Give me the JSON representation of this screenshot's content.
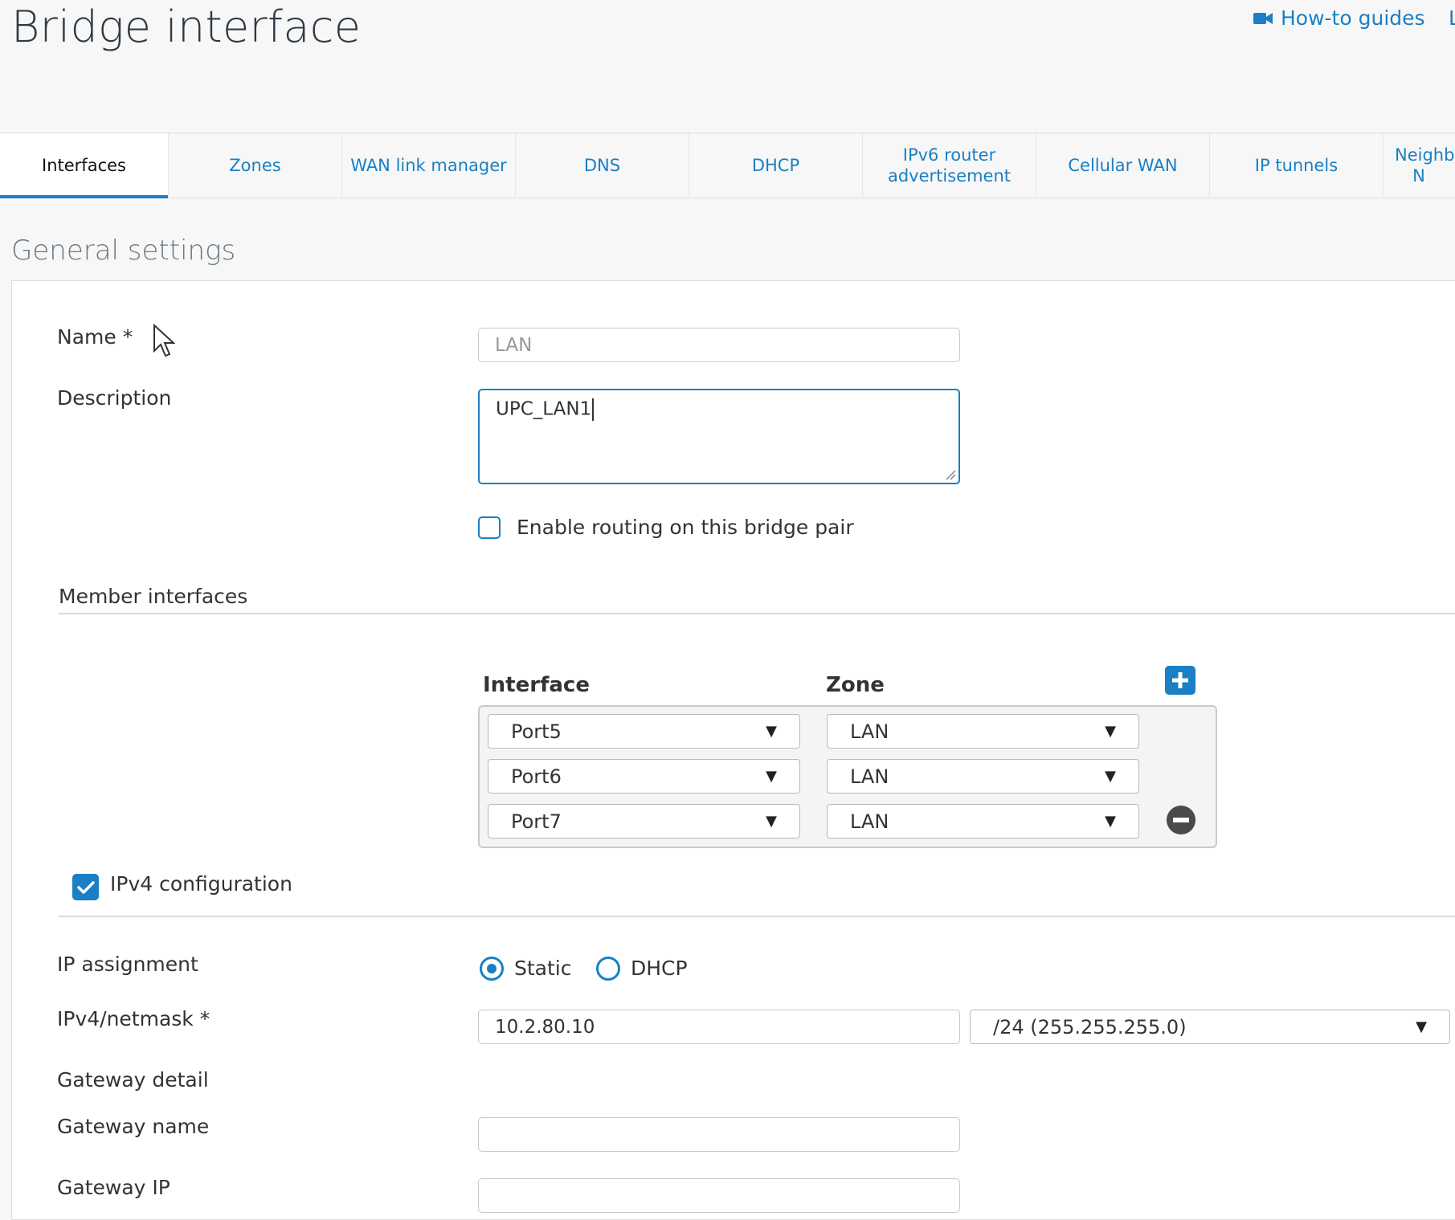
{
  "header": {
    "title": "Bridge interface",
    "howto_label": "How-to guides",
    "edge_link": "L"
  },
  "tabs": [
    {
      "label": "Interfaces",
      "active": true
    },
    {
      "label": "Zones"
    },
    {
      "label": "WAN link manager"
    },
    {
      "label": "DNS"
    },
    {
      "label": "DHCP"
    },
    {
      "label": "IPv6 router advertisement"
    },
    {
      "label": "Cellular WAN"
    },
    {
      "label": "IP tunnels"
    },
    {
      "label": "Neighb N"
    }
  ],
  "general": {
    "section_title": "General settings",
    "name_label": "Name *",
    "name_value": "LAN",
    "description_label": "Description",
    "description_value": "UPC_LAN1",
    "routing_label": "Enable routing on this bridge pair"
  },
  "members": {
    "heading": "Member interfaces",
    "col_interface": "Interface",
    "col_zone": "Zone",
    "rows": [
      {
        "interface": "Port5",
        "zone": "LAN"
      },
      {
        "interface": "Port6",
        "zone": "LAN"
      },
      {
        "interface": "Port7",
        "zone": "LAN"
      }
    ]
  },
  "ipv4": {
    "heading": "IPv4 configuration",
    "assignment_label": "IP assignment",
    "static_label": "Static",
    "dhcp_label": "DHCP",
    "netmask_label": "IPv4/netmask *",
    "ip_value": "10.2.80.10",
    "netmask_value": "/24 (255.255.255.0)",
    "gateway_detail": "Gateway detail",
    "gateway_name_label": "Gateway name",
    "gateway_ip_label": "Gateway IP",
    "gateway_name_value": "",
    "gateway_ip_value": ""
  },
  "colors": {
    "accent": "#1a7fc4",
    "background": "#f7f7f7",
    "panel": "#ffffff"
  }
}
